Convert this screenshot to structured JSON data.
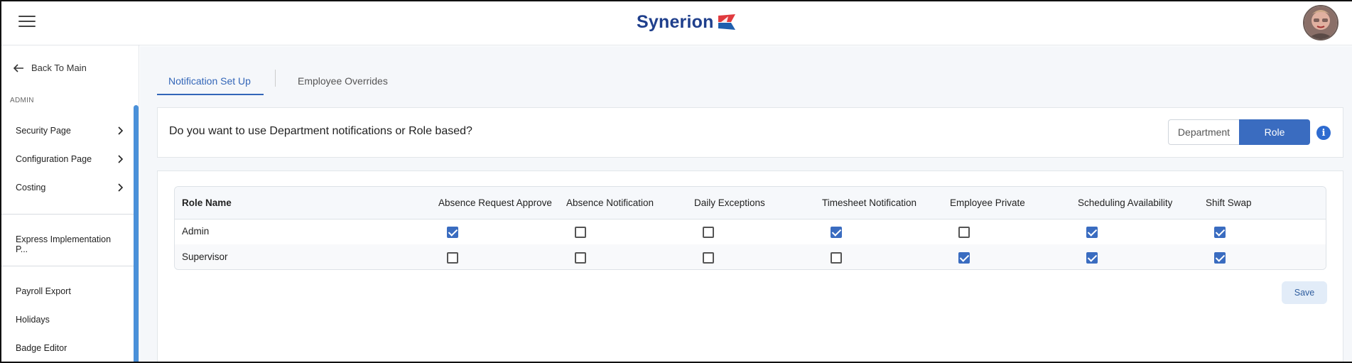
{
  "header": {
    "logo_text": "Synerion",
    "menu_icon": "hamburger-menu-icon",
    "avatar_icon": "user-avatar"
  },
  "sidebar": {
    "back_label": "Back To Main",
    "section_label": "ADMIN",
    "items": [
      {
        "label": "Security Page",
        "has_submenu": true
      },
      {
        "label": "Configuration Page",
        "has_submenu": true
      },
      {
        "label": "Costing",
        "has_submenu": true
      },
      {
        "label": "Express Implementation P...",
        "has_submenu": false
      },
      {
        "label": "Payroll Export",
        "has_submenu": false
      },
      {
        "label": "Holidays",
        "has_submenu": false
      },
      {
        "label": "Badge Editor",
        "has_submenu": false
      }
    ]
  },
  "tabs": [
    {
      "label": "Notification Set Up",
      "active": true
    },
    {
      "label": "Employee Overrides",
      "active": false
    }
  ],
  "question": {
    "text": "Do you want to use Department notifications or Role based?",
    "options": [
      "Department",
      "Role"
    ],
    "selected": "Role",
    "info_icon": "info-icon"
  },
  "table": {
    "columns": [
      "Role Name",
      "Absence Request Approve",
      "Absence Notification",
      "Daily Exceptions",
      "Timesheet Notification",
      "Employee Private",
      "Scheduling Availability",
      "Shift Swap"
    ],
    "rows": [
      {
        "name": "Admin",
        "values": [
          true,
          false,
          false,
          true,
          false,
          true,
          true
        ]
      },
      {
        "name": "Supervisor",
        "values": [
          false,
          false,
          false,
          false,
          true,
          true,
          true
        ]
      }
    ]
  },
  "save_label": "Save",
  "colors": {
    "accent": "#3a6cc0",
    "brand_text": "#1f3f8c",
    "logo_red": "#e03a3e",
    "logo_blue": "#1f5fae"
  }
}
